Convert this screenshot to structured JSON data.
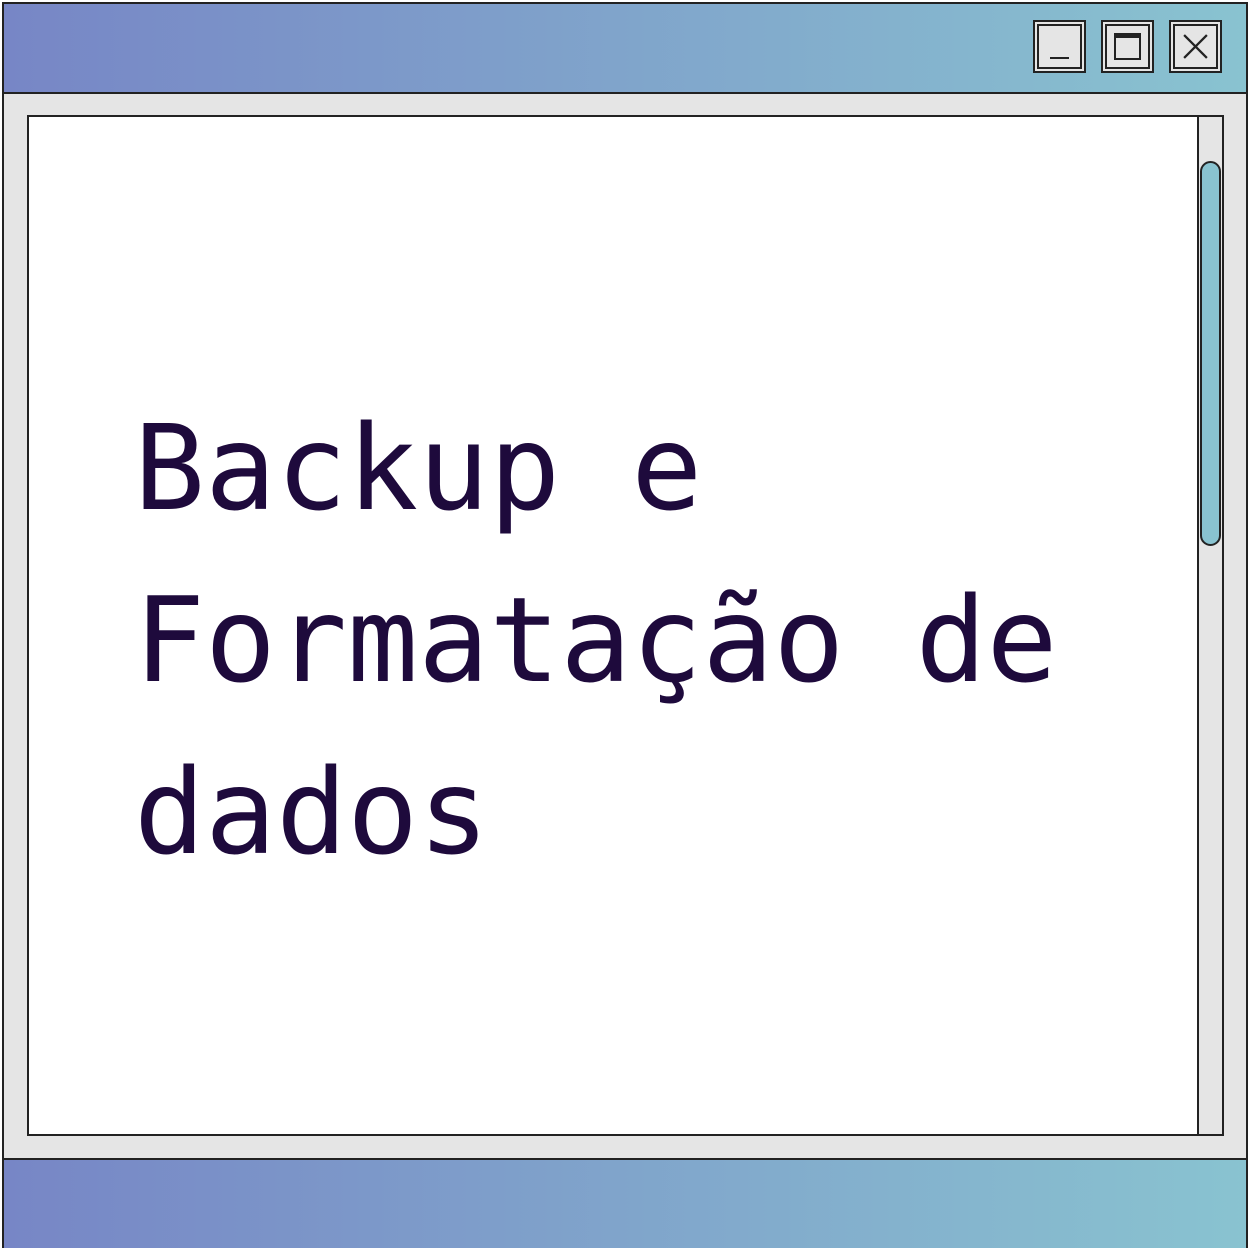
{
  "window": {
    "title_lines": [
      "Backup e",
      "Formatação de",
      "dados"
    ]
  },
  "controls": {
    "minimize": "minimize-icon",
    "maximize": "maximize-icon",
    "close": "close-icon"
  },
  "colors": {
    "titlebar_start": "#7786c6",
    "titlebar_end": "#89c3d0",
    "text": "#1e0a3c",
    "frame": "#e5e5e5",
    "scroll_thumb": "#89c3d0"
  }
}
